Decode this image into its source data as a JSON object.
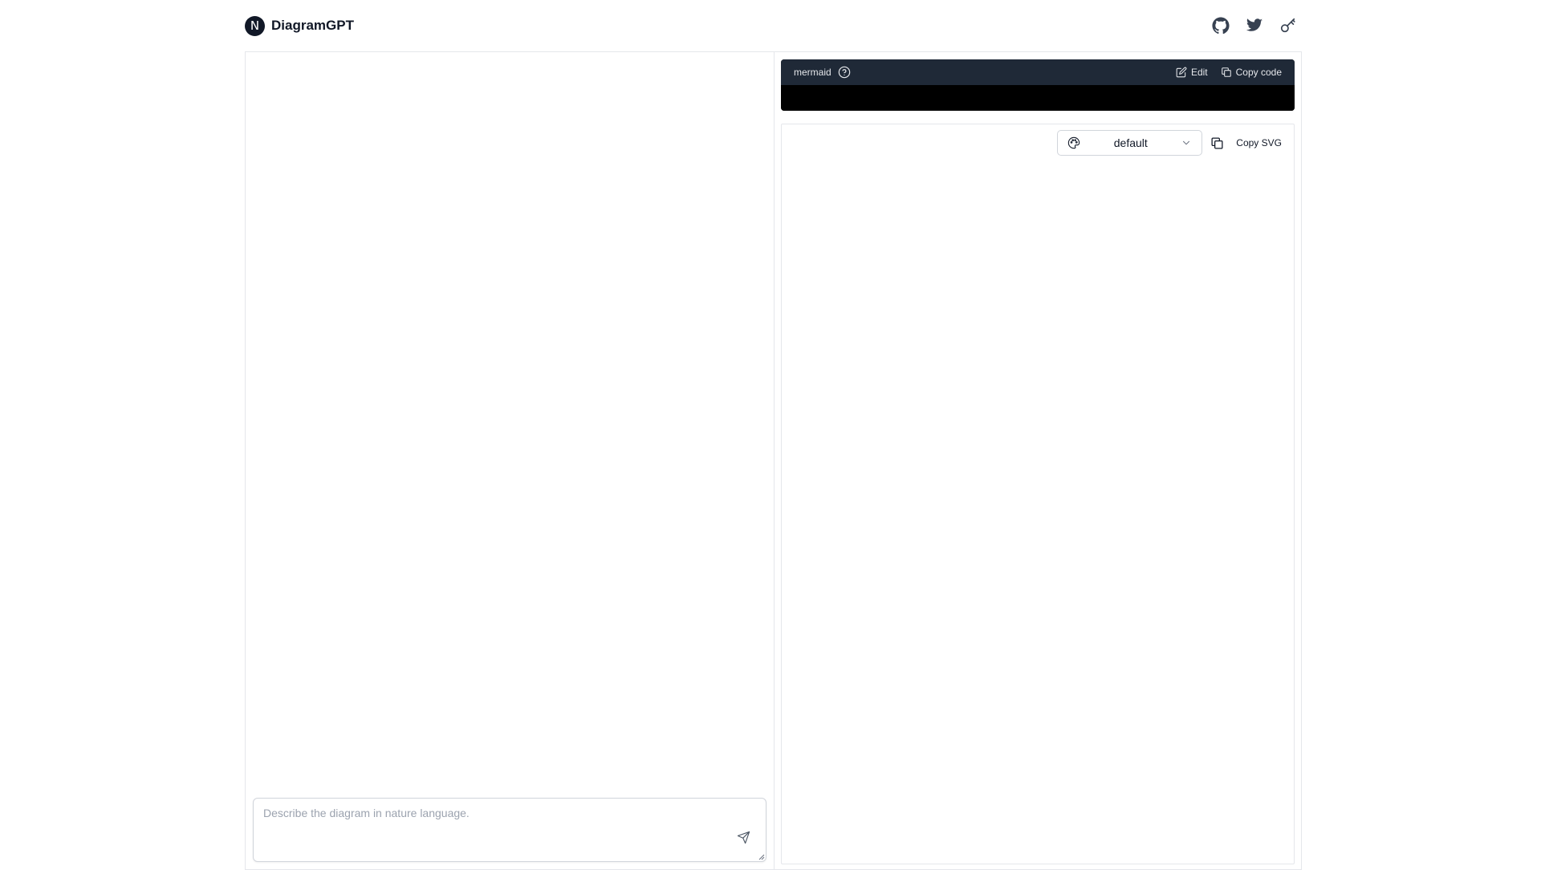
{
  "header": {
    "logo_letter": "N",
    "app_name": "DiagramGPT",
    "icons": [
      "github-icon",
      "twitter-icon",
      "key-icon"
    ]
  },
  "chat": {
    "placeholder": "Describe the diagram in nature language.",
    "value": ""
  },
  "code_panel": {
    "language": "mermaid",
    "edit_label": "Edit",
    "copy_code_label": "Copy code"
  },
  "preview": {
    "theme_value": "default",
    "copy_svg_label": "Copy SVG"
  },
  "colors": {
    "code_bar": "#1f2937",
    "code_body": "#000000",
    "border": "#e5e7eb",
    "text": "#111827"
  }
}
